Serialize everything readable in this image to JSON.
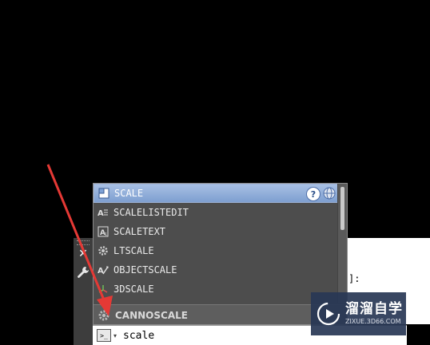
{
  "popup": {
    "items": [
      {
        "label": "SCALE",
        "icon": "scale-command-icon",
        "selected": true
      },
      {
        "label": "SCALELISTEDIT",
        "icon": "scale-list-edit-icon"
      },
      {
        "label": "SCALETEXT",
        "icon": "scale-text-icon"
      },
      {
        "label": "LTSCALE",
        "icon": "gear-icon"
      },
      {
        "label": "OBJECTSCALE",
        "icon": "object-scale-icon"
      },
      {
        "label": "3DSCALE",
        "icon": "3d-scale-icon"
      }
    ],
    "help_glyph": "?",
    "category": {
      "label": "CANNOSCALE",
      "icon": "gear-icon"
    }
  },
  "text_window": {
    "fragment": "]:"
  },
  "dock": {
    "close_glyph": "✕"
  },
  "command_line": {
    "value": "scale",
    "prompt_glyph": ">_",
    "dropdown_glyph": "▾"
  },
  "watermark": {
    "title": "溜溜自学",
    "subtitle": "ZIXUE.3D66.COM"
  },
  "colors": {
    "selection": "#8aa8d8",
    "popup_bg": "#4d4d4d",
    "annotation_arrow": "#e53935"
  }
}
